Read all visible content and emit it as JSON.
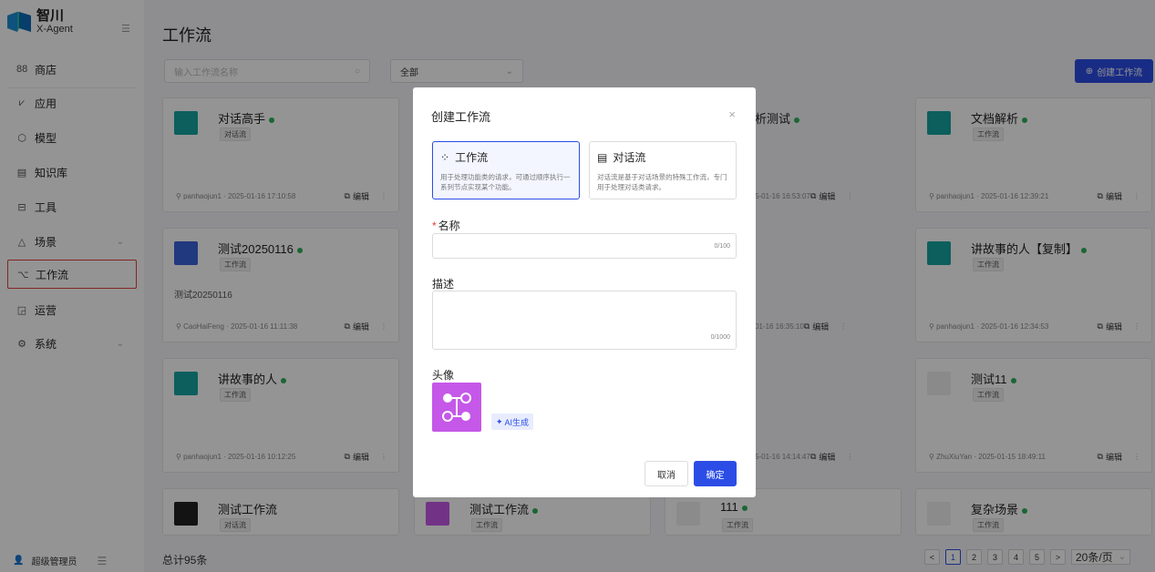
{
  "app": {
    "name": "智川",
    "sub": "X-Agent"
  },
  "sidebar": {
    "items": [
      {
        "label": "商店",
        "icon": "store-icon"
      },
      {
        "label": "应用",
        "icon": "app-icon"
      },
      {
        "label": "模型",
        "icon": "model-icon"
      },
      {
        "label": "知识库",
        "icon": "knowledge-icon"
      },
      {
        "label": "工具",
        "icon": "tool-icon"
      },
      {
        "label": "场景",
        "icon": "scene-icon"
      },
      {
        "label": "工作流",
        "icon": "workflow-icon",
        "active": true
      },
      {
        "label": "运营",
        "icon": "operations-icon"
      },
      {
        "label": "系统",
        "icon": "system-icon"
      }
    ],
    "user": "超级管理员"
  },
  "header": {
    "title": "工作流"
  },
  "toolbar": {
    "search_placeholder": "输入工作流名称",
    "filter_value": "全部",
    "create_label": "创建工作流"
  },
  "cards": [
    {
      "title": "对话高手",
      "tag": "对话流",
      "desc": "",
      "user": "panhaojun1",
      "time": "2025-01-16 17:10:58",
      "edit": "编辑",
      "status": true
    },
    {
      "title": "析测试",
      "tag": "",
      "desc": "",
      "user": "",
      "time": "5-01-16 16:53:07",
      "edit": "编辑",
      "status": true
    },
    {
      "title": "文档解析",
      "tag": "工作流",
      "desc": "",
      "user": "panhaojun1",
      "time": "2025-01-16 12:39:21",
      "edit": "编辑",
      "status": true
    },
    {
      "title": "测试20250116",
      "tag": "工作流",
      "desc": "测试20250116",
      "user": "CaoHaiFeng",
      "time": "2025-01-16 11:11:38",
      "edit": "编辑",
      "status": true
    },
    {
      "title": "",
      "tag": "",
      "desc": "",
      "user": "",
      "time": "01-16 16:35:10",
      "edit": "编辑",
      "status": false
    },
    {
      "title": "讲故事的人【复制】",
      "tag": "工作流",
      "desc": "",
      "user": "panhaojun1",
      "time": "2025-01-16 12:34:53",
      "edit": "编辑",
      "status": true
    },
    {
      "title": "讲故事的人",
      "tag": "工作流",
      "desc": "",
      "user": "panhaojun1",
      "time": "2025-01-16 10:12:25",
      "edit": "编辑",
      "status": true
    },
    {
      "title": "",
      "tag": "",
      "desc": "",
      "user": "",
      "time": "5-01-16 14:14:47",
      "edit": "编辑",
      "status": false
    },
    {
      "title": "测试11",
      "tag": "工作流",
      "desc": "",
      "user": "ZhuXiuYan",
      "time": "2025-01-15 18:49:11",
      "edit": "编辑",
      "status": true
    },
    {
      "title": "测试工作流",
      "tag": "对话流",
      "status": false
    },
    {
      "title": "测试工作流",
      "tag": "工作流",
      "status": true
    },
    {
      "title": "111",
      "tag": "工作流",
      "status": true
    },
    {
      "title": "复杂场景",
      "tag": "工作流",
      "status": true
    }
  ],
  "footer": {
    "total": "总计95条",
    "pages": [
      "1",
      "2",
      "3",
      "4",
      "5"
    ],
    "prev": "<",
    "next": ">",
    "page_size": "20条/页"
  },
  "modal": {
    "title": "创建工作流",
    "close": "×",
    "types": [
      {
        "label": "工作流",
        "desc": "用于处理功能类的请求，可通过顺序执行一系列节点实现某个功能。",
        "selected": true
      },
      {
        "label": "对话流",
        "desc": "对话流是基于对话场景的特殊工作流，专门用于处理对话类请求。",
        "selected": false
      }
    ],
    "name_label": "名称",
    "name_required": "*",
    "name_count": "0/100",
    "desc_label": "描述",
    "desc_count": "0/1000",
    "avatar_label": "头像",
    "ai_label": "AI生成",
    "cancel": "取消",
    "confirm": "确定"
  },
  "colors": {
    "primary": "#2b4de6",
    "avatar_teal": "#15a4a0",
    "avatar_blue": "#3a63d9",
    "avatar_purple": "#c558e8",
    "status_green": "#2fb05a"
  }
}
